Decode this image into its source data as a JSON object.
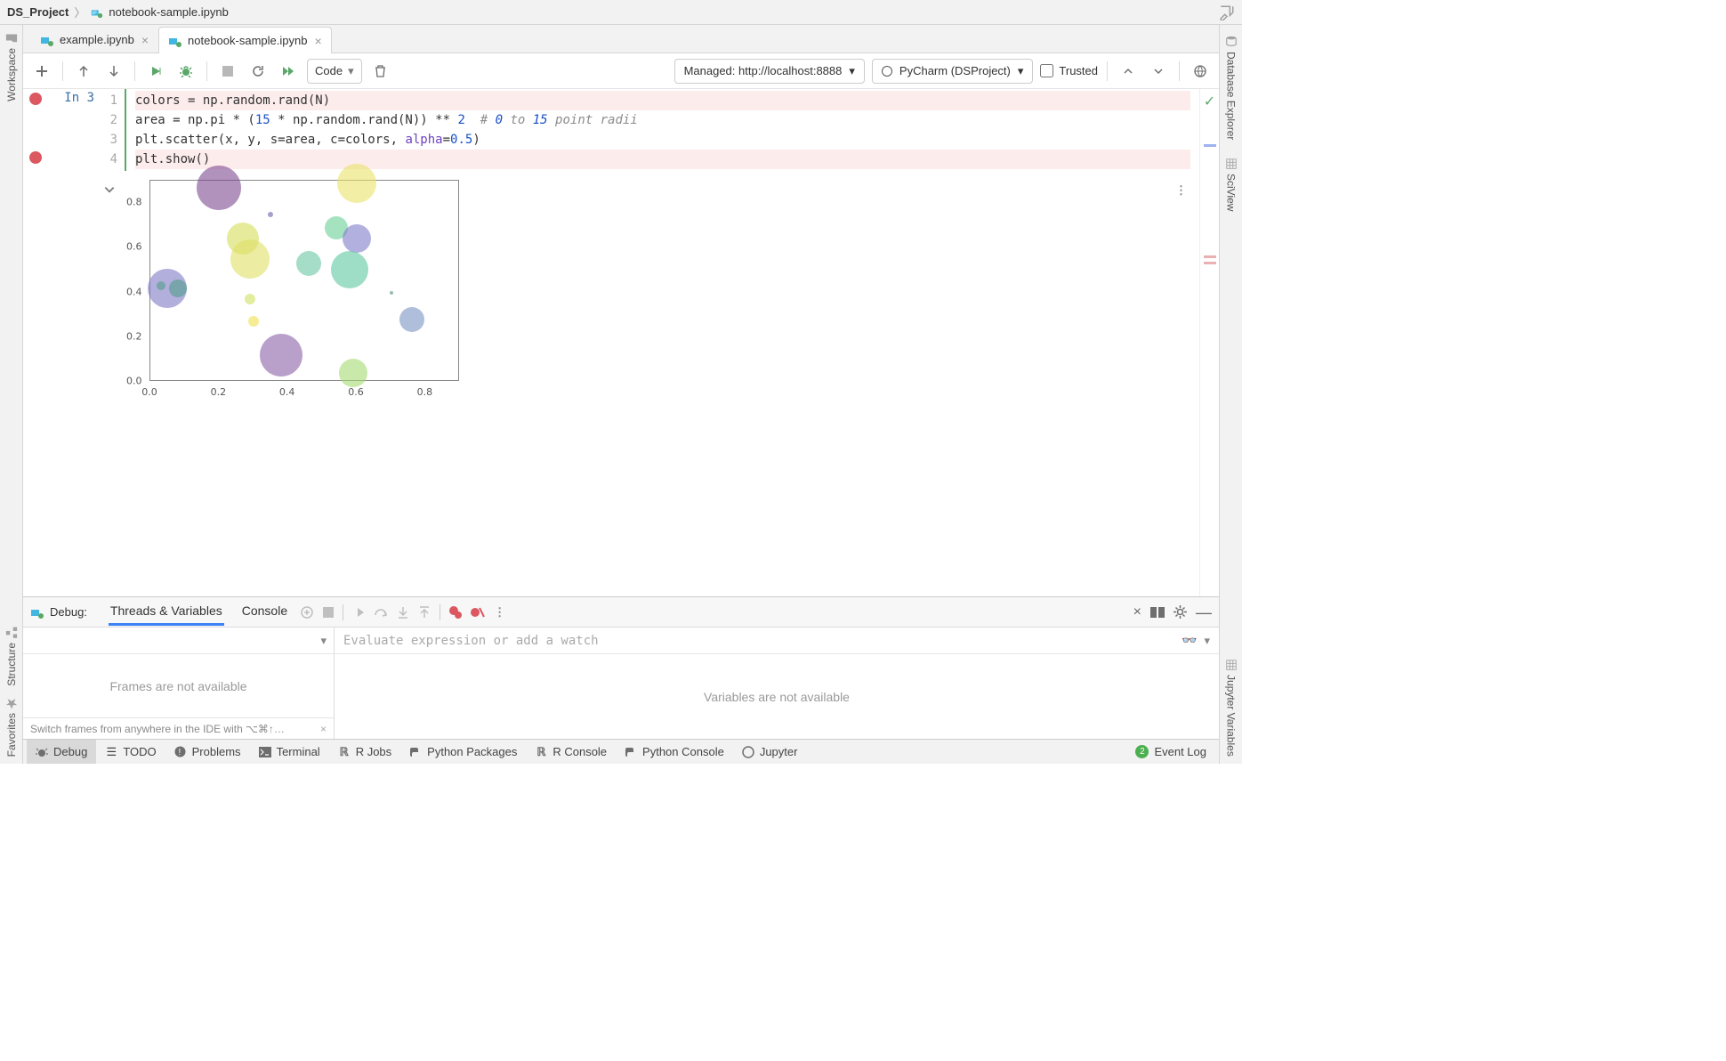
{
  "breadcrumb": {
    "project": "DS_Project",
    "file": "notebook-sample.ipynb"
  },
  "tabs": [
    {
      "label": "example.ipynb",
      "active": false
    },
    {
      "label": "notebook-sample.ipynb",
      "active": true
    }
  ],
  "toolbar": {
    "cell_type": "Code",
    "server_label": "Managed: http://localhost:8888",
    "kernel_label": "PyCharm (DSProject)",
    "trusted_label": "Trusted"
  },
  "cell": {
    "prompt": "In 3",
    "lines": [
      "colors = np.random.rand(N)",
      "area = np.pi * (15 * np.random.rand(N)) ** 2  # 0 to 15 point radii",
      "plt.scatter(x, y, s=area, c=colors, alpha=0.5)",
      "plt.show()"
    ],
    "line_nums": [
      "1",
      "2",
      "3",
      "4"
    ]
  },
  "chart_data": {
    "type": "scatter",
    "title": "",
    "xlabel": "",
    "ylabel": "",
    "xlim": [
      0.0,
      0.9
    ],
    "ylim": [
      0.0,
      0.9
    ],
    "xticks": [
      0.0,
      0.2,
      0.4,
      0.6,
      0.8
    ],
    "yticks": [
      0.0,
      0.2,
      0.4,
      0.6,
      0.8
    ],
    "points": [
      {
        "x": 0.2,
        "y": 0.87,
        "r": 25,
        "color": "#7d4a8f"
      },
      {
        "x": 0.6,
        "y": 0.89,
        "r": 22,
        "color": "#e9e26b"
      },
      {
        "x": 0.27,
        "y": 0.64,
        "r": 18,
        "color": "#d6de59"
      },
      {
        "x": 0.35,
        "y": 0.75,
        "r": 3,
        "color": "#6a5fb0"
      },
      {
        "x": 0.29,
        "y": 0.55,
        "r": 22,
        "color": "#dfe066"
      },
      {
        "x": 0.46,
        "y": 0.53,
        "r": 14,
        "color": "#6bc6a3"
      },
      {
        "x": 0.54,
        "y": 0.69,
        "r": 13,
        "color": "#69cf96"
      },
      {
        "x": 0.6,
        "y": 0.64,
        "r": 16,
        "color": "#7e7bc8"
      },
      {
        "x": 0.58,
        "y": 0.5,
        "r": 21,
        "color": "#5ec7a0"
      },
      {
        "x": 0.05,
        "y": 0.42,
        "r": 22,
        "color": "#8079c5"
      },
      {
        "x": 0.08,
        "y": 0.42,
        "r": 10,
        "color": "#4f9f8a"
      },
      {
        "x": 0.03,
        "y": 0.43,
        "r": 5,
        "color": "#4f9f8a"
      },
      {
        "x": 0.29,
        "y": 0.37,
        "r": 6,
        "color": "#cfe160"
      },
      {
        "x": 0.3,
        "y": 0.27,
        "r": 6,
        "color": "#efe04e"
      },
      {
        "x": 0.76,
        "y": 0.28,
        "r": 14,
        "color": "#7a93c1"
      },
      {
        "x": 0.38,
        "y": 0.12,
        "r": 24,
        "color": "#8b61a8"
      },
      {
        "x": 0.59,
        "y": 0.04,
        "r": 16,
        "color": "#a4db6f"
      },
      {
        "x": 0.7,
        "y": 0.4,
        "r": 2,
        "color": "#5e8c7a"
      }
    ]
  },
  "debug": {
    "title": "Debug:",
    "tabs": {
      "threads": "Threads & Variables",
      "console": "Console"
    },
    "frames_msg": "Frames are not available",
    "vars_msg": "Variables are not available",
    "eval_placeholder": "Evaluate expression or add a watch",
    "tip": "Switch frames from anywhere in the IDE with ⌥⌘↑…"
  },
  "left_rail": {
    "workspace": "Workspace",
    "structure": "Structure",
    "favorites": "Favorites"
  },
  "right_rail": {
    "db": "Database Explorer",
    "sv": "SciView",
    "jv": "Jupyter Variables"
  },
  "statusbar": {
    "debug": "Debug",
    "todo": "TODO",
    "problems": "Problems",
    "terminal": "Terminal",
    "rjobs": "R Jobs",
    "pypkg": "Python Packages",
    "rconsole": "R Console",
    "pyconsole": "Python Console",
    "jupyter": "Jupyter",
    "eventlog": "Event Log",
    "event_badge": "2"
  }
}
